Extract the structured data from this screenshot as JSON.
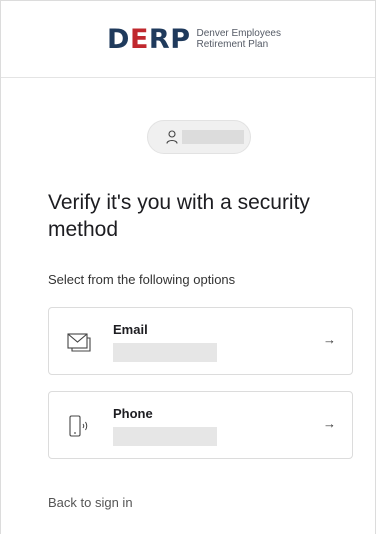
{
  "brand": {
    "mark_letters": [
      "D",
      "E",
      "R",
      "P"
    ],
    "name_line1": "Denver Employees",
    "name_line2": "Retirement Plan"
  },
  "user": {
    "identifier": "",
    "icon": "user-icon"
  },
  "main": {
    "title": "Verify it's you with a security method",
    "subtitle": "Select from the following options"
  },
  "options": [
    {
      "label": "Email",
      "icon": "mail-icon",
      "detail": "",
      "arrow": "→"
    },
    {
      "label": "Phone",
      "icon": "phone-icon",
      "detail": "",
      "arrow": "→"
    }
  ],
  "footer": {
    "back_link": "Back to sign in"
  },
  "colors": {
    "brand_navy": "#1f3a5c",
    "brand_red": "#c0282e"
  }
}
